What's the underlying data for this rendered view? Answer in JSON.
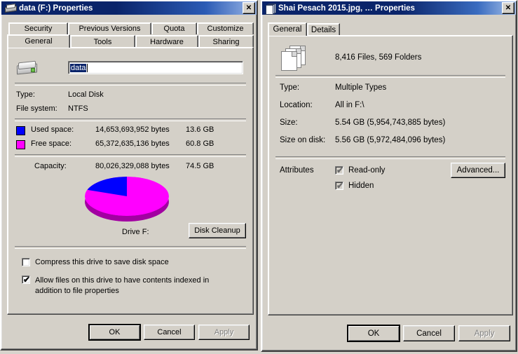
{
  "left_window": {
    "title": "data (F:) Properties",
    "icon": "hard-drive-icon",
    "close_label": "✕",
    "tabs_row1": [
      "Security",
      "Previous Versions",
      "Quota",
      "Customize"
    ],
    "tabs_row2": [
      "General",
      "Tools",
      "Hardware",
      "Sharing"
    ],
    "active_tab": "General",
    "volume_name": "data",
    "fields": [
      {
        "label": "Type:",
        "value": "Local Disk"
      },
      {
        "label": "File system:",
        "value": "NTFS"
      }
    ],
    "space": [
      {
        "label": "Used space:",
        "bytes": "14,653,693,952 bytes",
        "size": "13.6 GB",
        "color": "#0000ff"
      },
      {
        "label": "Free space:",
        "bytes": "65,372,635,136 bytes",
        "size": "60.8 GB",
        "color": "#ff00ff"
      }
    ],
    "capacity": {
      "label": "Capacity:",
      "bytes": "80,026,329,088 bytes",
      "size": "74.5 GB"
    },
    "drive_caption": "Drive F:",
    "disk_cleanup_label": "Disk Cleanup",
    "checkboxes": [
      {
        "label": "Compress this drive to save disk space",
        "checked": false
      },
      {
        "label": "Allow files on this drive to have contents indexed in addition to file properties",
        "checked": true
      }
    ],
    "buttons": {
      "ok": "OK",
      "cancel": "Cancel",
      "apply": "Apply"
    }
  },
  "right_window": {
    "title": "Shai Pesach 2015.jpg, … Properties",
    "icon": "multiple-files-icon",
    "close_label": "✕",
    "tabs": [
      "General",
      "Details"
    ],
    "active_tab": "General",
    "summary": "8,416 Files, 569 Folders",
    "fields": [
      {
        "label": "Type:",
        "value": "Multiple Types"
      },
      {
        "label": "Location:",
        "value": "All in F:\\"
      },
      {
        "label": "Size:",
        "value": "5.54 GB (5,954,743,885 bytes)"
      },
      {
        "label": "Size on disk:",
        "value": "5.56 GB (5,972,484,096 bytes)"
      }
    ],
    "attributes_label": "Attributes",
    "attributes": [
      {
        "label": "Read-only",
        "state": "mixed"
      },
      {
        "label": "Hidden",
        "state": "mixed"
      }
    ],
    "advanced_label": "Advanced...",
    "buttons": {
      "ok": "OK",
      "cancel": "Cancel",
      "apply": "Apply"
    }
  },
  "chart_data": {
    "type": "pie",
    "title": "Drive F:",
    "categories": [
      "Used space",
      "Free space"
    ],
    "values": [
      14653693952,
      65372635136
    ],
    "labels": [
      "13.6 GB",
      "60.8 GB"
    ],
    "percentages": [
      18.3,
      81.7
    ],
    "colors": [
      "#0000ff",
      "#ff00ff"
    ],
    "total": 80026329088,
    "total_label": "74.5 GB",
    "legend": "inline-left",
    "style": "3d"
  }
}
